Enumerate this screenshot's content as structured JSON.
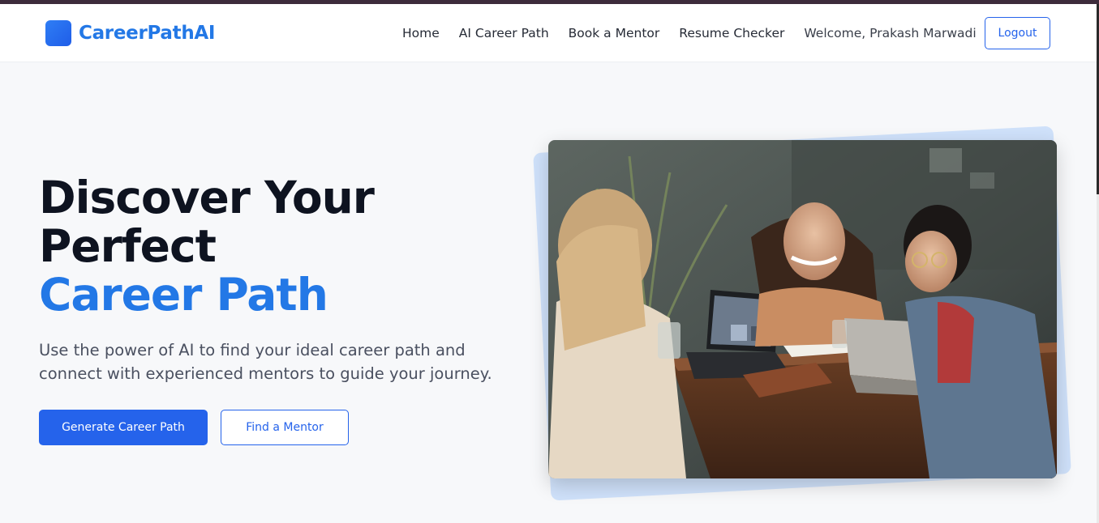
{
  "brand": {
    "name": "CareerPathAI",
    "accent_color": "#2378e6",
    "logo_icon": "gradient-square-icon"
  },
  "nav": {
    "items": [
      {
        "label": "Home"
      },
      {
        "label": "AI Career Path"
      },
      {
        "label": "Book a Mentor"
      },
      {
        "label": "Resume Checker"
      }
    ],
    "welcome": "Welcome, Prakash Marwadi",
    "logout_label": "Logout"
  },
  "hero": {
    "title_line1": "Discover Your",
    "title_line2": "Perfect",
    "title_accent": "Career Path",
    "subtitle": "Use the power of AI to find your ideal career path and connect with experienced mentors to guide your journey.",
    "primary_button": "Generate Career Path",
    "secondary_button": "Find a Mentor",
    "primary_color": "#2563eb"
  },
  "image": {
    "subject": "three people laughing around a wooden table with laptops",
    "icon": "photo-image"
  }
}
